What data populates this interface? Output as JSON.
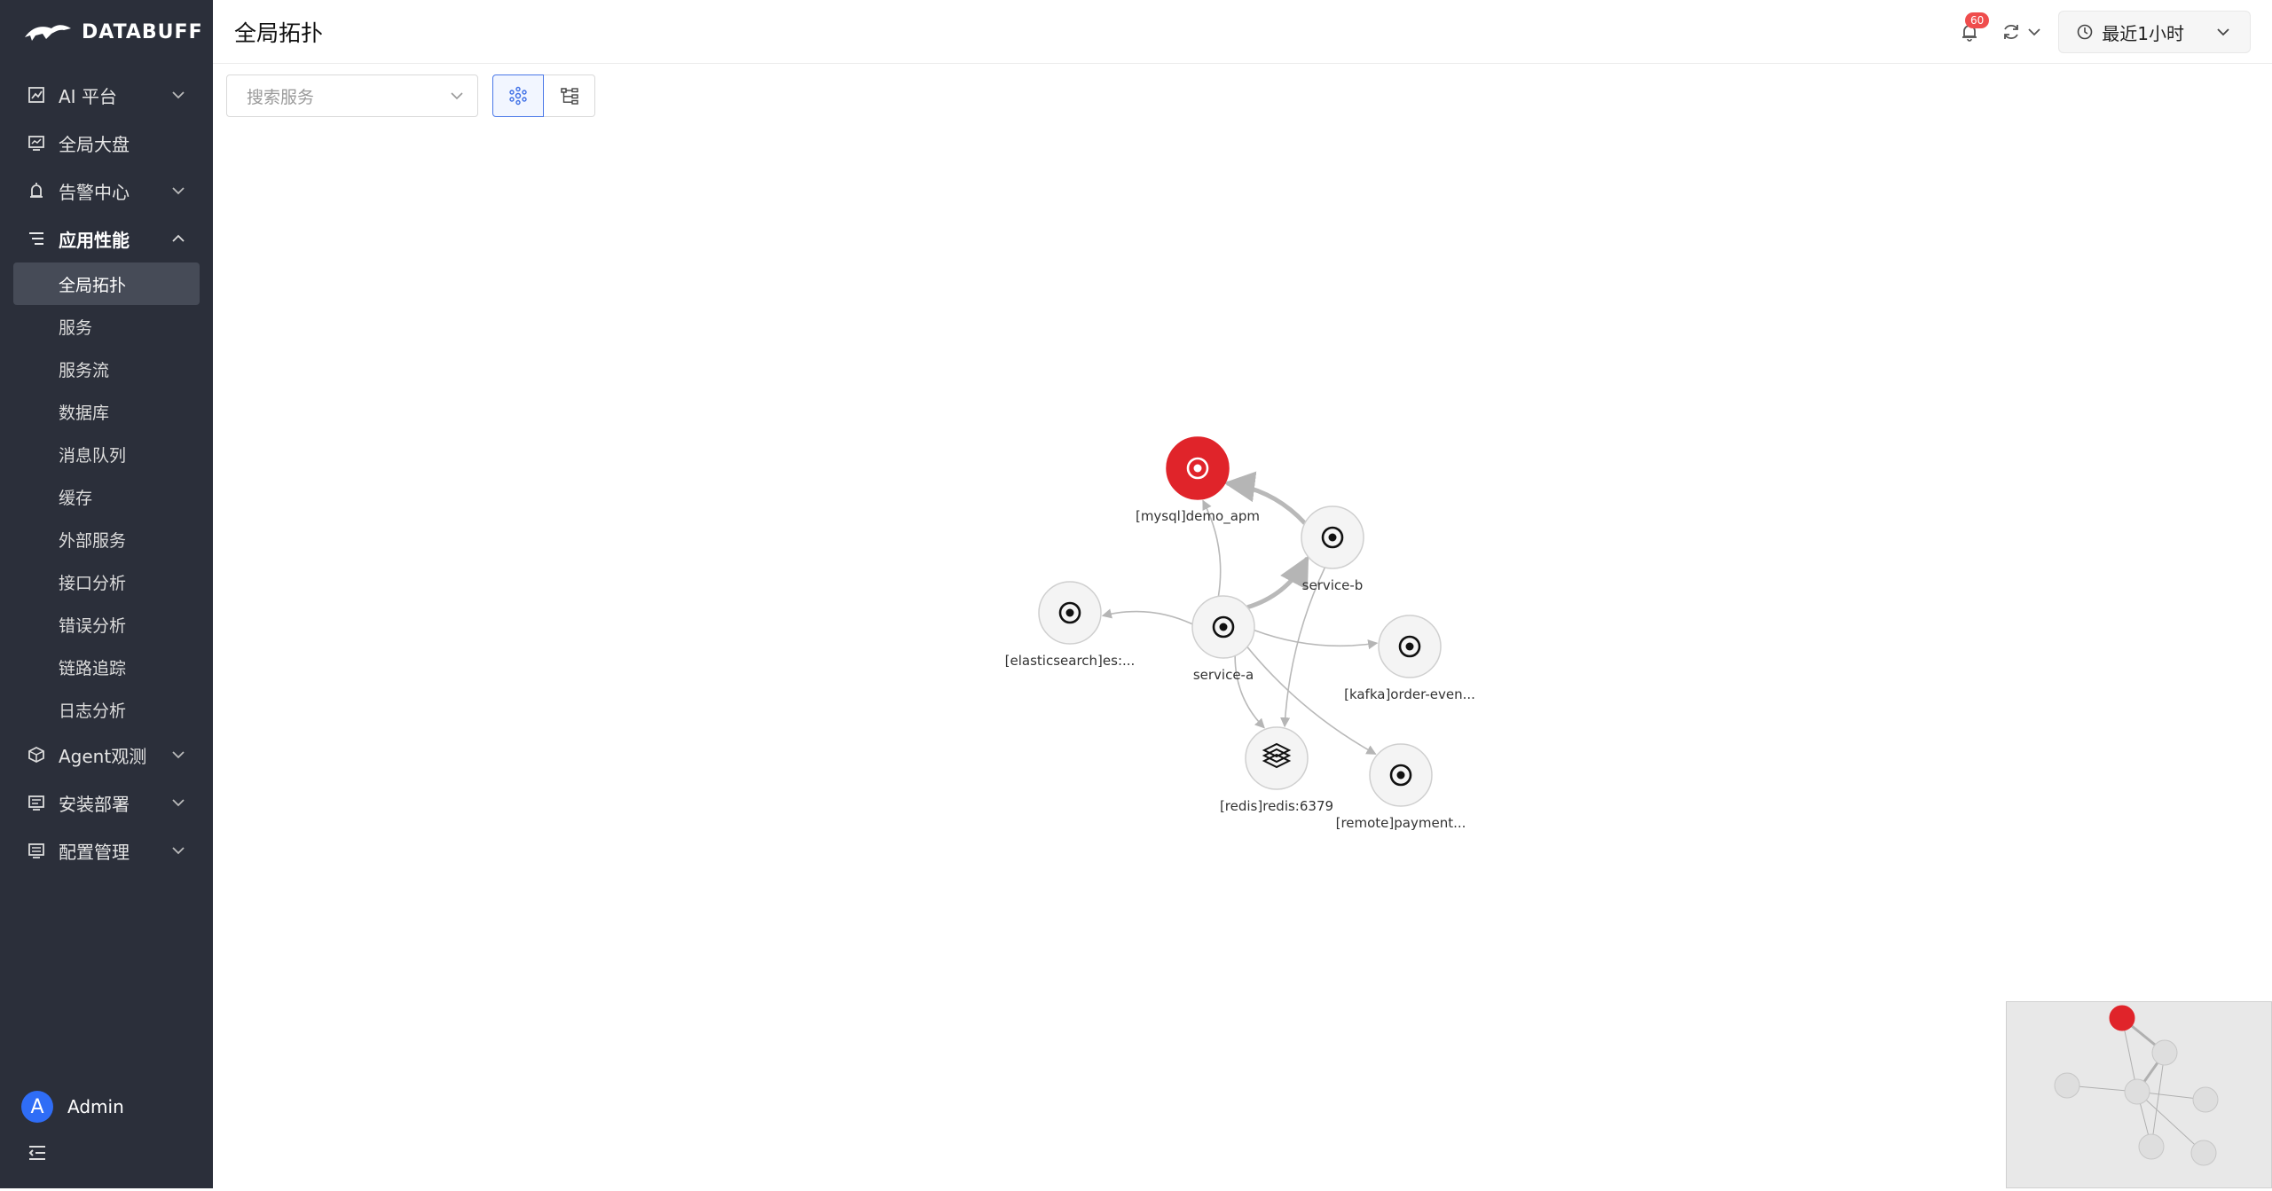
{
  "app": {
    "logo_text": "DATABUFF"
  },
  "sidebar": {
    "items": [
      {
        "label": "AI 平台",
        "icon": "chart-icon",
        "expandable": true,
        "expanded": false
      },
      {
        "label": "全局大盘",
        "icon": "monitor-icon",
        "expandable": false
      },
      {
        "label": "告警中心",
        "icon": "alarm-icon",
        "expandable": true,
        "expanded": false
      },
      {
        "label": "应用性能",
        "icon": "list-icon",
        "expandable": true,
        "expanded": true,
        "children": [
          {
            "label": "全局拓扑",
            "active": true
          },
          {
            "label": "服务"
          },
          {
            "label": "服务流"
          },
          {
            "label": "数据库"
          },
          {
            "label": "消息队列"
          },
          {
            "label": "缓存"
          },
          {
            "label": "外部服务"
          },
          {
            "label": "接口分析"
          },
          {
            "label": "错误分析"
          },
          {
            "label": "链路追踪"
          },
          {
            "label": "日志分析"
          }
        ]
      },
      {
        "label": "Agent观测",
        "icon": "cube-icon",
        "expandable": true,
        "expanded": false
      },
      {
        "label": "安装部署",
        "icon": "install-icon",
        "expandable": true,
        "expanded": false
      },
      {
        "label": "配置管理",
        "icon": "settings-icon",
        "expandable": true,
        "expanded": false
      }
    ],
    "user": {
      "avatar_letter": "A",
      "name": "Admin"
    }
  },
  "header": {
    "title": "全局拓扑",
    "notifications_count": "60",
    "time_range": "最近1小时"
  },
  "toolbar": {
    "search_placeholder": "搜索服务"
  },
  "topology": {
    "nodes": [
      {
        "id": "mysql",
        "label": "[mysql]demo_apm",
        "status": "error",
        "icon": "target-icon"
      },
      {
        "id": "service-b",
        "label": "service-b",
        "status": "normal",
        "icon": "target-icon"
      },
      {
        "id": "service-a",
        "label": "service-a",
        "status": "normal",
        "icon": "target-icon"
      },
      {
        "id": "es",
        "label": "[elasticsearch]es:...",
        "status": "normal",
        "icon": "target-icon"
      },
      {
        "id": "kafka",
        "label": "[kafka]order-even...",
        "status": "normal",
        "icon": "target-icon"
      },
      {
        "id": "redis",
        "label": "[redis]redis:6379",
        "status": "normal",
        "icon": "layers-icon"
      },
      {
        "id": "remote",
        "label": "[remote]payment...",
        "status": "normal",
        "icon": "target-icon"
      }
    ],
    "edges": [
      {
        "from": "service-b",
        "to": "mysql",
        "weight": "thick"
      },
      {
        "from": "service-a",
        "to": "service-b",
        "weight": "thick"
      },
      {
        "from": "service-a",
        "to": "mysql",
        "weight": "thin"
      },
      {
        "from": "service-a",
        "to": "es",
        "weight": "thin"
      },
      {
        "from": "service-a",
        "to": "kafka",
        "weight": "thin"
      },
      {
        "from": "service-a",
        "to": "redis",
        "weight": "thin"
      },
      {
        "from": "service-a",
        "to": "remote",
        "weight": "thin"
      },
      {
        "from": "service-b",
        "to": "redis",
        "weight": "thin"
      }
    ],
    "colors": {
      "error": "#e0242a",
      "normal_fill": "#f4f4f4",
      "edge": "#b9b9b9"
    }
  }
}
